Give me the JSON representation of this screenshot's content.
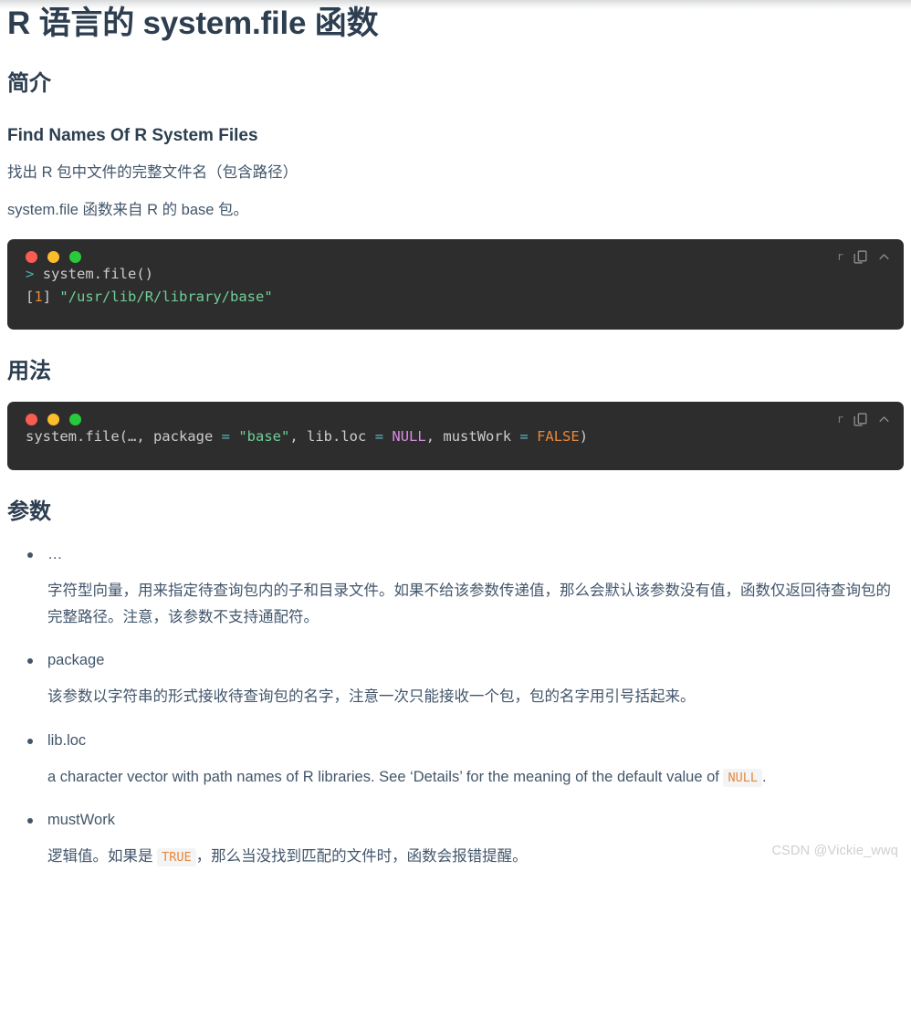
{
  "document": {
    "title": "R 语言的 system.file 函数",
    "watermark": "CSDN @Vickie_wwq"
  },
  "sections": {
    "intro": {
      "heading": "简介",
      "subheading": "Find Names Of R System Files",
      "paragraph_1": "找出 R 包中文件的完整文件名（包含路径）",
      "paragraph_2": "system.file 函数来自 R 的 base 包。",
      "code_block": {
        "lang_label": "r",
        "copy_icon": "copy-icon",
        "collapse_icon": "chevron-up-icon",
        "lines": [
          {
            "prompt": ">",
            "code": "system.file()"
          },
          {
            "index": "[1]",
            "string": "\"/usr/lib/R/library/base\""
          }
        ]
      }
    },
    "usage": {
      "heading": "用法",
      "code_block": {
        "lang_label": "r",
        "copy_icon": "copy-icon",
        "collapse_icon": "chevron-up-icon",
        "signature": {
          "fn": "system.file(…, package",
          "eq1": "=",
          "str": "\"base\"",
          "mid1": ", lib.loc",
          "eq2": "=",
          "nul": "NULL",
          "mid2": ", mustWork",
          "eq3": "=",
          "bool": "FALSE",
          "close": ")"
        }
      }
    },
    "arguments": {
      "heading": "参数",
      "items": [
        {
          "name": "…",
          "desc_1": "字符型向量，用来指定待查询包内的子和目录文件。如果不给该参数传递值，那么会默认该参数没有值，函数仅返回待查询包的完整路径。注意，该参数不支持通配符。"
        },
        {
          "name": "package",
          "desc_1": "该参数以字符串的形式接收待查询包的名字，注意一次只能接收一个包，包的名字用引号括起来。"
        },
        {
          "name": "lib.loc",
          "desc_pre": "a character vector with path names of R libraries. See ‘Details’ for the meaning of the default value of",
          "desc_code": "NULL",
          "desc_post": "."
        },
        {
          "name": "mustWork",
          "desc_pre": "逻辑值。如果是",
          "desc_code": "TRUE",
          "desc_post": "，那么当没找到匹配的文件时，函数会报错提醒。"
        }
      ]
    }
  },
  "colors": {
    "heading": "#2c3e50",
    "body_text": "#42566b",
    "code_bg": "#2d2d2d",
    "dot_red": "#fa5c54",
    "dot_amber": "#fcbc2c",
    "dot_green": "#29c93c",
    "string": "#6fcf97",
    "number": "#e8883a",
    "prompt": "#3fb6ad",
    "operator": "#56b6c2",
    "null": "#d98ae0",
    "boolean": "#e8883a",
    "inline_code": "#e8883a",
    "inline_code_bg": "#f3f4f5",
    "watermark": "#cfcfcf"
  }
}
